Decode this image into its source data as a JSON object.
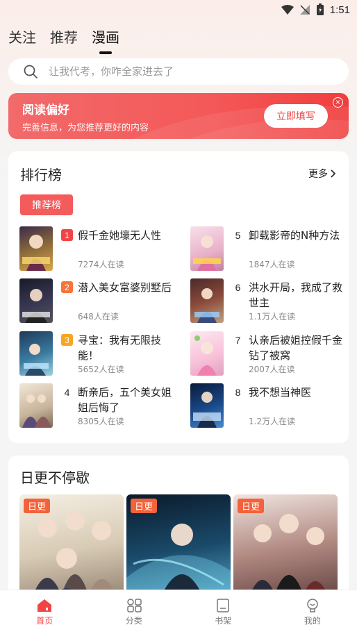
{
  "status_bar": {
    "time": "1:51"
  },
  "top_tabs": [
    {
      "label": "关注"
    },
    {
      "label": "推荐"
    },
    {
      "label": "漫画",
      "active": true
    }
  ],
  "search": {
    "placeholder": "让我代考，你咋全家进去了"
  },
  "banner": {
    "title": "阅读偏好",
    "subtitle": "完善信息，为您推荐更好的内容",
    "button": "立即填写",
    "close_icon": "close-circle-icon"
  },
  "ranking": {
    "title": "排行榜",
    "more": "更多",
    "chip": "推荐榜",
    "items": [
      {
        "rank": "1",
        "title": "假千金她壕无人性",
        "readers": "7274人在读"
      },
      {
        "rank": "2",
        "title": "潜入美女富婆别墅后",
        "readers": "648人在读"
      },
      {
        "rank": "3",
        "title": "寻宝：我有无限技能！",
        "readers": "5652人在读"
      },
      {
        "rank": "4",
        "title": "断亲后，五个美女姐姐后悔了",
        "readers": "8305人在读"
      },
      {
        "rank": "5",
        "title": "卸载影帝的N种方法",
        "readers": "1847人在读"
      },
      {
        "rank": "6",
        "title": "洪水开局，我成了救世主",
        "readers": "1.1万人在读"
      },
      {
        "rank": "7",
        "title": "认亲后被姐控假千金钻了被窝",
        "readers": "2007人在读"
      },
      {
        "rank": "8",
        "title": "我不想当神医",
        "readers": "1.2万人在读"
      }
    ]
  },
  "daily": {
    "title": "日更不停歇",
    "badges": [
      "日更",
      "日更",
      "日更"
    ]
  },
  "bottom_nav": [
    {
      "label": "首页",
      "icon": "home-icon",
      "active": true
    },
    {
      "label": "分类",
      "icon": "category-icon"
    },
    {
      "label": "书架",
      "icon": "bookshelf-icon"
    },
    {
      "label": "我的",
      "icon": "profile-icon"
    }
  ],
  "colors": {
    "accent": "#f04545",
    "rank1": "#f04545",
    "rank2": "#f7743a",
    "rank3": "#f5a623",
    "badge": "#f3623a"
  }
}
